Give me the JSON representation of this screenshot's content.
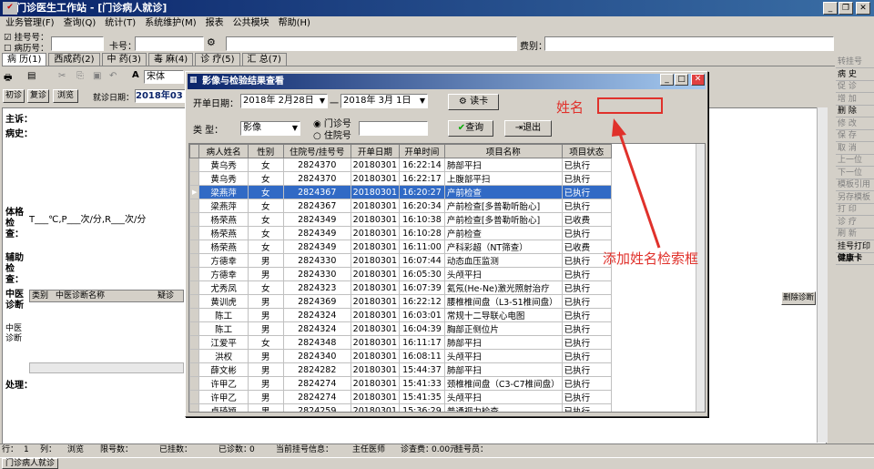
{
  "app": {
    "title": "门诊医生工作站 - [门诊病人就诊]"
  },
  "menu": [
    "业务管理(F)",
    "查询(Q)",
    "统计(T)",
    "系统维护(M)",
    "报表",
    "公共模块",
    "帮助(H)"
  ],
  "header": {
    "chk_guahao": "挂号号：",
    "chk_bingli": "病历号：",
    "card_label": "卡号：",
    "fee_label": "费别："
  },
  "tabs": [
    "病 历(1)",
    "西成药(2)",
    "中 药(3)",
    "毒 麻(4)",
    "诊 疗(5)",
    "汇 总(7)"
  ],
  "left": {
    "font_value": "宋体",
    "subtabs": [
      "初诊",
      "复诊",
      "浏览"
    ],
    "visit_date_label": "就诊日期：",
    "visit_date_value": "2018年03",
    "zhusu": "主诉：",
    "bingshi": "病史：",
    "tige": "体格检查：",
    "tige_text": "T___℃,P___次/分,R___次/分",
    "fuzhu": "辅助检查：",
    "zhongyi": "中医诊断",
    "zhongyi2": "中医诊断",
    "diag_cols": [
      "类别",
      "中医诊断名称",
      "疑诊"
    ],
    "chuli": "处理："
  },
  "right_buttons": [
    "转挂号",
    "病 史",
    "促 诊",
    "增 加",
    "删 除",
    "修 改",
    "保 存",
    "取 消",
    "上一位",
    "下一位",
    "模板引用",
    "另存模板",
    "打 印",
    "诊 疗",
    "刷 新",
    "挂号打印",
    "健康卡",
    "删除诊断"
  ],
  "status": {
    "row": "行：",
    "row_val": "1",
    "col": "列：",
    "col_val": "浏览",
    "limit": "限号数：",
    "guahao": "已挂数：",
    "yizhen": "已诊数：",
    "yizhen_val": "0",
    "current": "当前挂号信息：",
    "doctor": "主任医师",
    "fee": "诊查费：",
    "fee_val": "0.00元",
    "guahao_staff": "挂号员："
  },
  "taskbar": "门诊病人就诊",
  "dialog": {
    "title": "影像与检验结果查看",
    "start_label": "开单日期：",
    "date_from": "2018年 2月28日",
    "sep": "一",
    "date_to": "2018年 3月 1日",
    "read_card": "读卡",
    "type_label": "类   型：",
    "type_value": "影像",
    "radio_menzhen": "门诊号",
    "radio_zhuyuan": "住院号",
    "query": "查询",
    "exit": "退出",
    "columns": [
      "病人姓名",
      "性别",
      "住院号/挂号号",
      "开单日期",
      "开单时间",
      "项目名称",
      "项目状态"
    ],
    "rows": [
      [
        "黄乌秀",
        "女",
        "2824370",
        "20180301",
        "16:22:14",
        "肺部平扫",
        "已执行"
      ],
      [
        "黄乌秀",
        "女",
        "2824370",
        "20180301",
        "16:22:17",
        "上腹部平扫",
        "已执行"
      ],
      [
        "梁燕萍",
        "女",
        "2824367",
        "20180301",
        "16:20:27",
        "产前检查",
        "已执行"
      ],
      [
        "梁燕萍",
        "女",
        "2824367",
        "20180301",
        "16:20:34",
        "产前检查[多普勒听胎心]",
        "已执行"
      ],
      [
        "杨荣燕",
        "女",
        "2824349",
        "20180301",
        "16:10:38",
        "产前检查[多普勒听胎心]",
        "已收费"
      ],
      [
        "杨荣燕",
        "女",
        "2824349",
        "20180301",
        "16:10:28",
        "产前检查",
        "已执行"
      ],
      [
        "杨荣燕",
        "女",
        "2824349",
        "20180301",
        "16:11:00",
        "产科彩超（NT筛查）",
        "已收费"
      ],
      [
        "方德幸",
        "男",
        "2824330",
        "20180301",
        "16:07:44",
        "动态血压监测",
        "已执行"
      ],
      [
        "方德幸",
        "男",
        "2824330",
        "20180301",
        "16:05:30",
        "头颅平扫",
        "已执行"
      ],
      [
        "尤秀凤",
        "女",
        "2824323",
        "20180301",
        "16:07:39",
        "氦氖(He-Ne)激光照射治疗",
        "已执行"
      ],
      [
        "黄训虎",
        "男",
        "2824369",
        "20180301",
        "16:22:12",
        "腰椎椎间盘（L3-S1椎间盘）",
        "已执行"
      ],
      [
        "陈工",
        "男",
        "2824324",
        "20180301",
        "16:03:01",
        "常规十二导联心电图",
        "已执行"
      ],
      [
        "陈工",
        "男",
        "2824324",
        "20180301",
        "16:04:39",
        "胸部正侧位片",
        "已执行"
      ],
      [
        "江爱平",
        "女",
        "2824348",
        "20180301",
        "16:11:17",
        "肺部平扫",
        "已执行"
      ],
      [
        "洪权",
        "男",
        "2824340",
        "20180301",
        "16:08:11",
        "头颅平扫",
        "已执行"
      ],
      [
        "薛文彬",
        "男",
        "2824282",
        "20180301",
        "15:44:37",
        "肺部平扫",
        "已执行"
      ],
      [
        "许甲乙",
        "男",
        "2824274",
        "20180301",
        "15:41:33",
        "颈椎椎间盘（C3-C7椎间盘）",
        "已执行"
      ],
      [
        "许甲乙",
        "男",
        "2824274",
        "20180301",
        "15:41:35",
        "头颅平扫",
        "已执行"
      ],
      [
        "卓琦颖",
        "男",
        "2824259",
        "20180301",
        "15:36:29",
        "普通视力检查",
        "已执行"
      ]
    ],
    "selected_row": 2
  },
  "annotations": {
    "name_label": "姓名",
    "add_text": "添加姓名检索框",
    "color": "#e0312b"
  }
}
